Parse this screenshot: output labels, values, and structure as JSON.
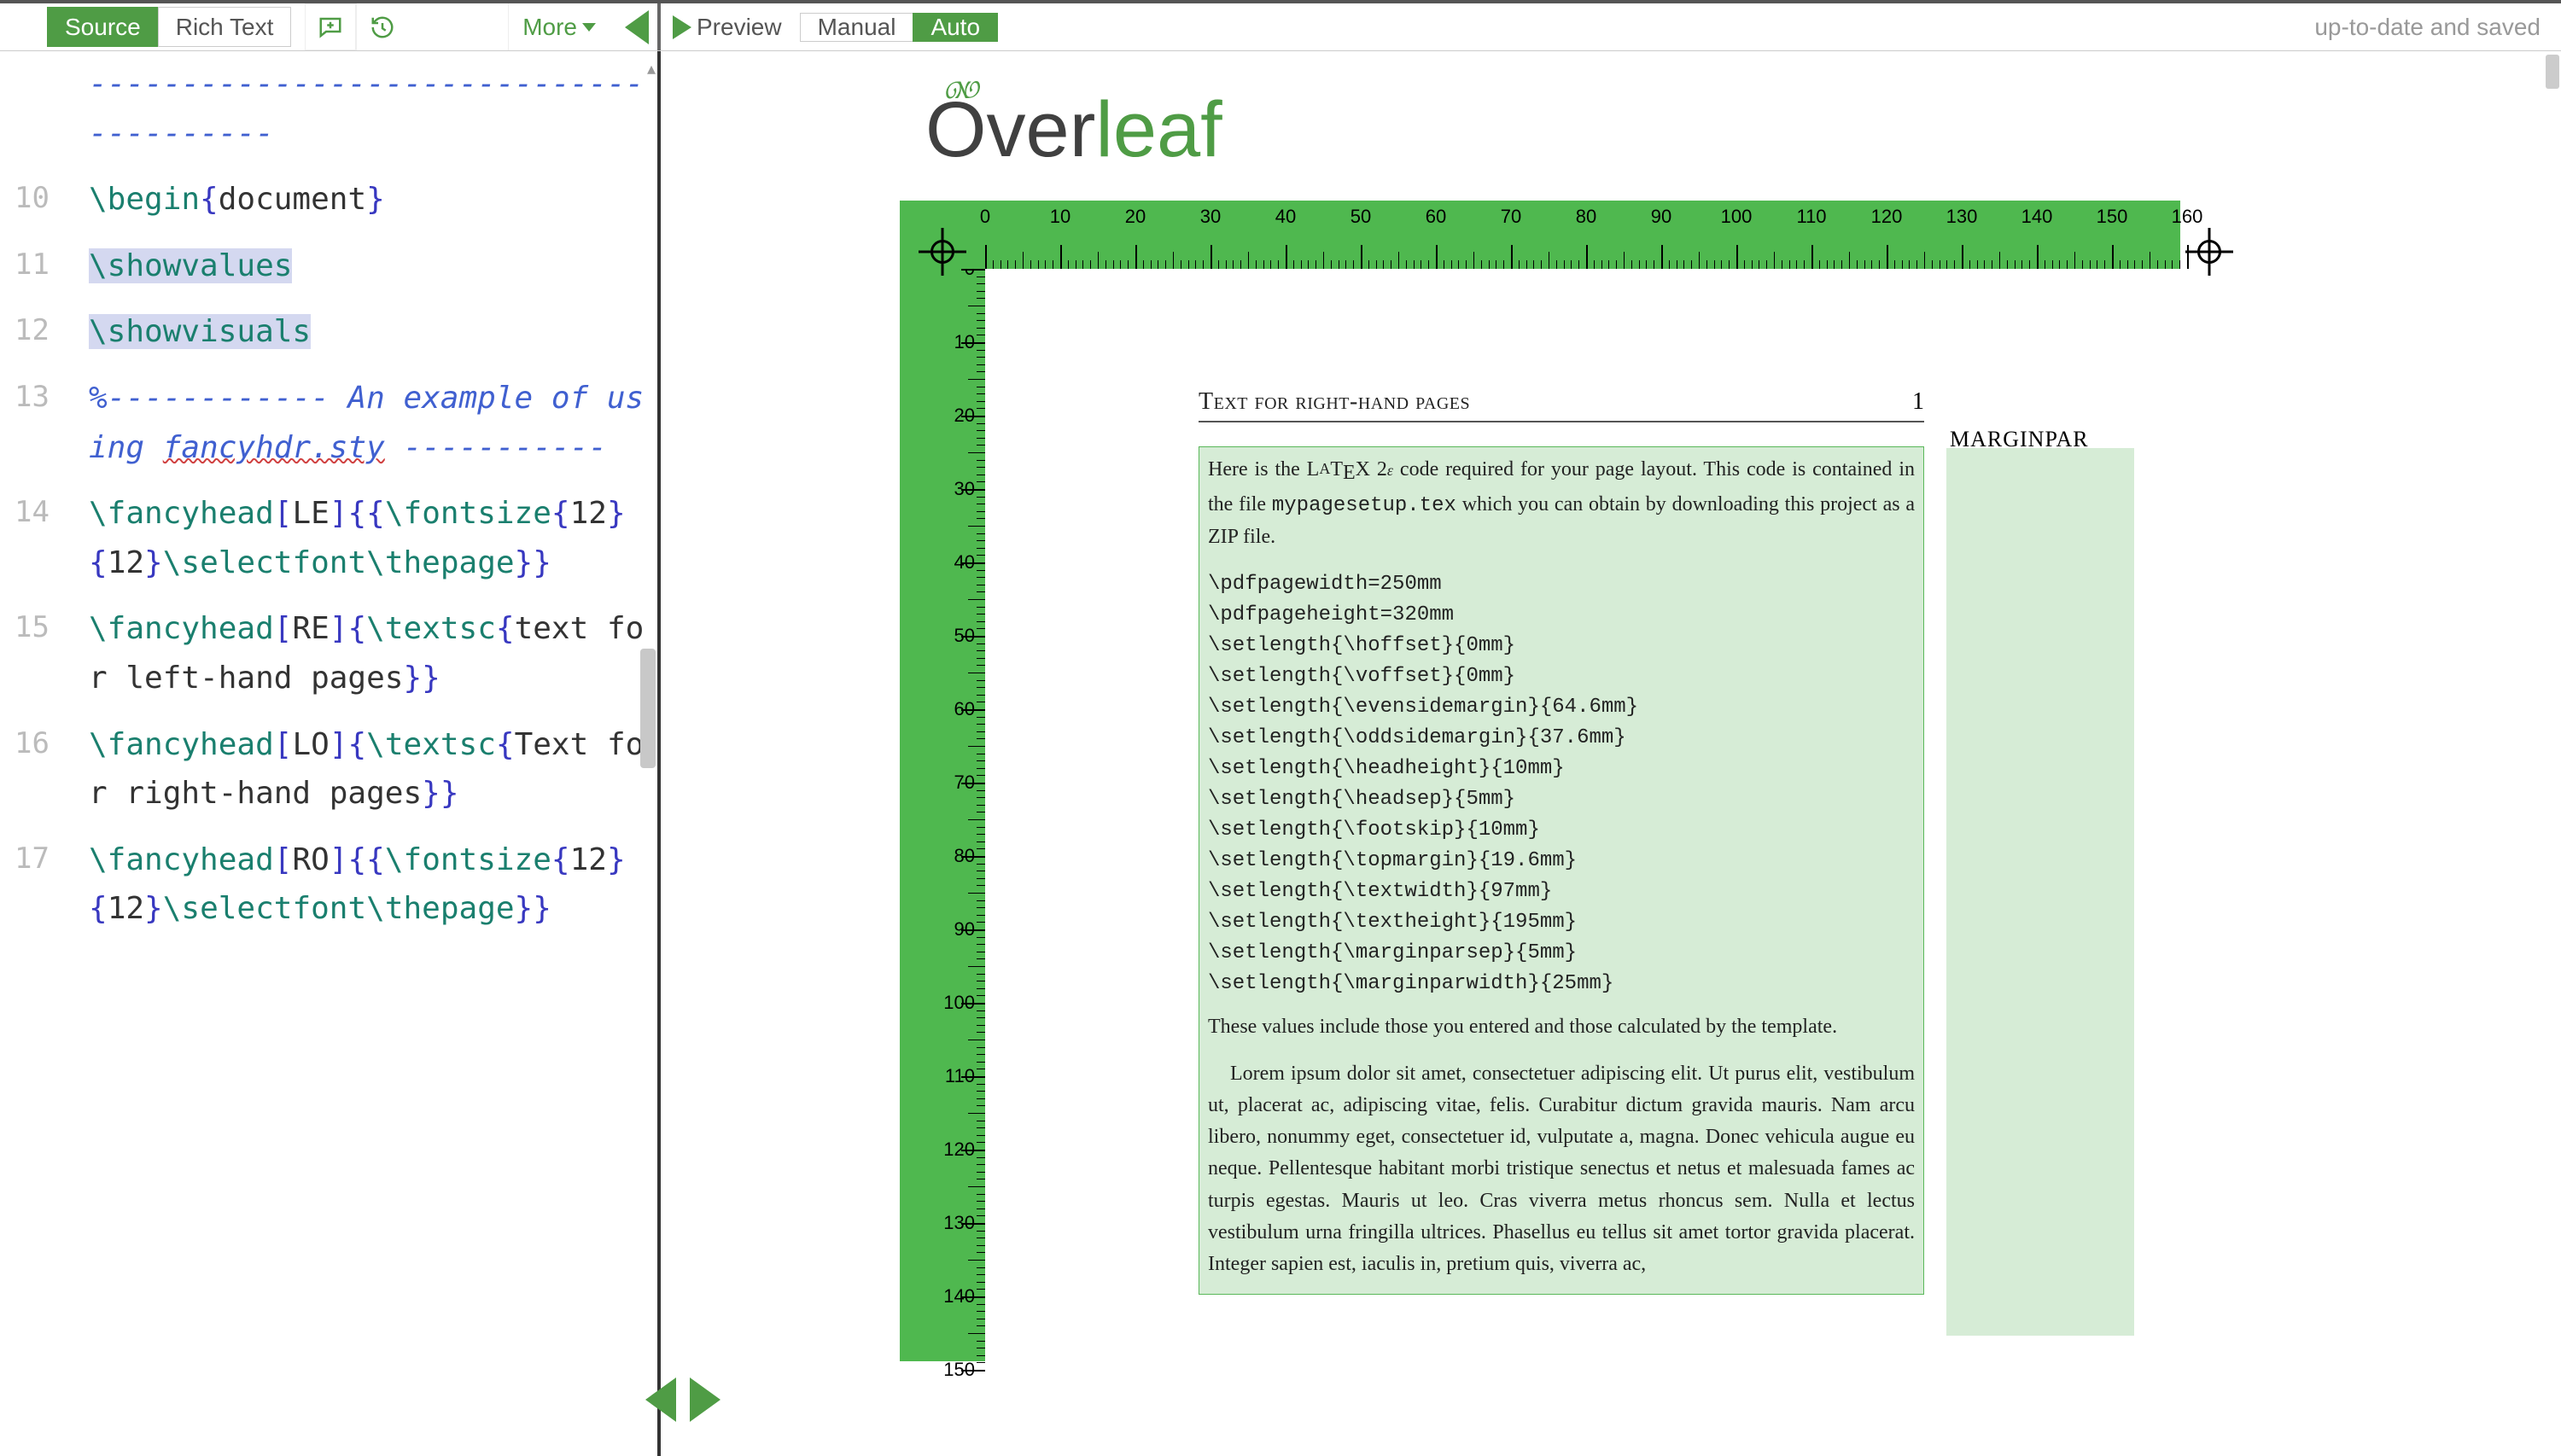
{
  "toolbar": {
    "source": "Source",
    "richtext": "Rich Text",
    "more": "More",
    "preview": "Preview",
    "manual": "Manual",
    "auto": "Auto",
    "status": "up-to-date and saved"
  },
  "editor": {
    "lines": [
      {
        "num": "",
        "segments": [
          {
            "t": "----------------------------------------",
            "c": "c-comment"
          }
        ]
      },
      {
        "num": "10",
        "segments": [
          {
            "t": "\\begin",
            "c": "c-cmd"
          },
          {
            "t": "{",
            "c": "c-brace"
          },
          {
            "t": "document",
            "c": "c-text"
          },
          {
            "t": "}",
            "c": "c-brace"
          }
        ]
      },
      {
        "num": "11",
        "selected": true,
        "segments": [
          {
            "t": "\\showvalues",
            "c": "c-cmd"
          }
        ]
      },
      {
        "num": "12",
        "selected": true,
        "segments": [
          {
            "t": "\\showvisuals",
            "c": "c-cmd"
          }
        ]
      },
      {
        "num": "13",
        "segments": [
          {
            "t": "%------------ An example of using ",
            "c": "c-comment"
          },
          {
            "t": "fancyhdr.sty",
            "c": "c-comment wavy"
          },
          {
            "t": " -----------",
            "c": "c-comment"
          }
        ]
      },
      {
        "num": "14",
        "segments": [
          {
            "t": "\\fancyhead",
            "c": "c-cmd"
          },
          {
            "t": "[",
            "c": "c-brace"
          },
          {
            "t": "LE",
            "c": "c-text"
          },
          {
            "t": "]",
            "c": "c-brace"
          },
          {
            "t": "{{",
            "c": "c-brace"
          },
          {
            "t": "\\fontsize",
            "c": "c-cmd"
          },
          {
            "t": "{",
            "c": "c-brace"
          },
          {
            "t": "12",
            "c": "c-text"
          },
          {
            "t": "}",
            "c": "c-brace"
          },
          {
            "t": "{",
            "c": "c-brace"
          },
          {
            "t": "12",
            "c": "c-text"
          },
          {
            "t": "}",
            "c": "c-brace"
          },
          {
            "t": "\\selectfont\\thepage",
            "c": "c-cmd"
          },
          {
            "t": "}}",
            "c": "c-brace"
          }
        ]
      },
      {
        "num": "15",
        "segments": [
          {
            "t": "\\fancyhead",
            "c": "c-cmd"
          },
          {
            "t": "[",
            "c": "c-brace"
          },
          {
            "t": "RE",
            "c": "c-text"
          },
          {
            "t": "]",
            "c": "c-brace"
          },
          {
            "t": "{",
            "c": "c-brace"
          },
          {
            "t": "\\textsc",
            "c": "c-cmd"
          },
          {
            "t": "{",
            "c": "c-brace"
          },
          {
            "t": "text for left-hand pages",
            "c": "c-text"
          },
          {
            "t": "}}",
            "c": "c-brace"
          }
        ]
      },
      {
        "num": "16",
        "segments": [
          {
            "t": "\\fancyhead",
            "c": "c-cmd"
          },
          {
            "t": "[",
            "c": "c-brace"
          },
          {
            "t": "LO",
            "c": "c-text"
          },
          {
            "t": "]",
            "c": "c-brace"
          },
          {
            "t": "{",
            "c": "c-brace"
          },
          {
            "t": "\\textsc",
            "c": "c-cmd"
          },
          {
            "t": "{",
            "c": "c-brace"
          },
          {
            "t": "Text for right-hand pages",
            "c": "c-text"
          },
          {
            "t": "}}",
            "c": "c-brace"
          }
        ]
      },
      {
        "num": "17",
        "segments": [
          {
            "t": "\\fancyhead",
            "c": "c-cmd"
          },
          {
            "t": "[",
            "c": "c-brace"
          },
          {
            "t": "RO",
            "c": "c-text"
          },
          {
            "t": "]",
            "c": "c-brace"
          },
          {
            "t": "{{",
            "c": "c-brace"
          },
          {
            "t": "\\fontsize",
            "c": "c-cmd"
          },
          {
            "t": "{",
            "c": "c-brace"
          },
          {
            "t": "12",
            "c": "c-text"
          },
          {
            "t": "}",
            "c": "c-brace"
          },
          {
            "t": "{",
            "c": "c-brace"
          },
          {
            "t": "12",
            "c": "c-text"
          },
          {
            "t": "}",
            "c": "c-brace"
          },
          {
            "t": "\\selectfont\\thepage",
            "c": "c-cmd"
          },
          {
            "t": "}}",
            "c": "c-brace"
          }
        ]
      }
    ]
  },
  "logo": {
    "leaf_char": "❝",
    "text_over": "Over",
    "text_leaf": "leaf"
  },
  "ruler": {
    "h_labels": [
      "0",
      "10",
      "20",
      "30",
      "40",
      "50",
      "60",
      "70",
      "80",
      "90",
      "100",
      "110",
      "120",
      "130",
      "140",
      "150",
      "160"
    ],
    "v_labels": [
      "0",
      "10",
      "20",
      "30",
      "40",
      "50",
      "60",
      "70",
      "80",
      "90",
      "100",
      "110",
      "120",
      "130",
      "140",
      "150"
    ]
  },
  "doc": {
    "header_title": "Text for right-hand pages",
    "header_page": "1",
    "marginpar": "MARGINPAR",
    "para1a": "Here is the L",
    "para1b": "T",
    "para1c": "X 2",
    "para1d": " code required for your page layout.  This code is contained in the file ",
    "para1file": "mypagesetup.tex",
    "para1e": " which you can obtain by downloading this project as a ZIP file.",
    "codeblock": "\\pdfpagewidth=250mm\n\\pdfpageheight=320mm\n\\setlength{\\hoffset}{0mm}\n\\setlength{\\voffset}{0mm}\n\\setlength{\\evensidemargin}{64.6mm}\n\\setlength{\\oddsidemargin}{37.6mm}\n\\setlength{\\headheight}{10mm}\n\\setlength{\\headsep}{5mm}\n\\setlength{\\footskip}{10mm}\n\\setlength{\\topmargin}{19.6mm}\n\\setlength{\\textwidth}{97mm}\n\\setlength{\\textheight}{195mm}\n\\setlength{\\marginparsep}{5mm}\n\\setlength{\\marginparwidth}{25mm}",
    "para2": "These values include those you entered and those calculated by the template.",
    "para3": "Lorem ipsum dolor sit amet, consectetuer adipiscing elit. Ut purus elit, vestibulum ut, placerat ac, adipiscing vitae, felis. Curabitur dictum gravida mauris.  Nam arcu libero, nonummy eget, consectetuer id, vulputate a, magna.  Donec vehicula augue eu neque.  Pellentesque habitant morbi tristique senectus et netus et malesuada fames ac turpis egestas.  Mauris ut leo. Cras viverra metus rhoncus sem.  Nulla et lectus vestibulum urna fringilla ultrices.  Phasellus eu tellus sit amet tortor gravida placerat.  Integer sapien est, iaculis in, pretium quis, viverra ac,"
  }
}
